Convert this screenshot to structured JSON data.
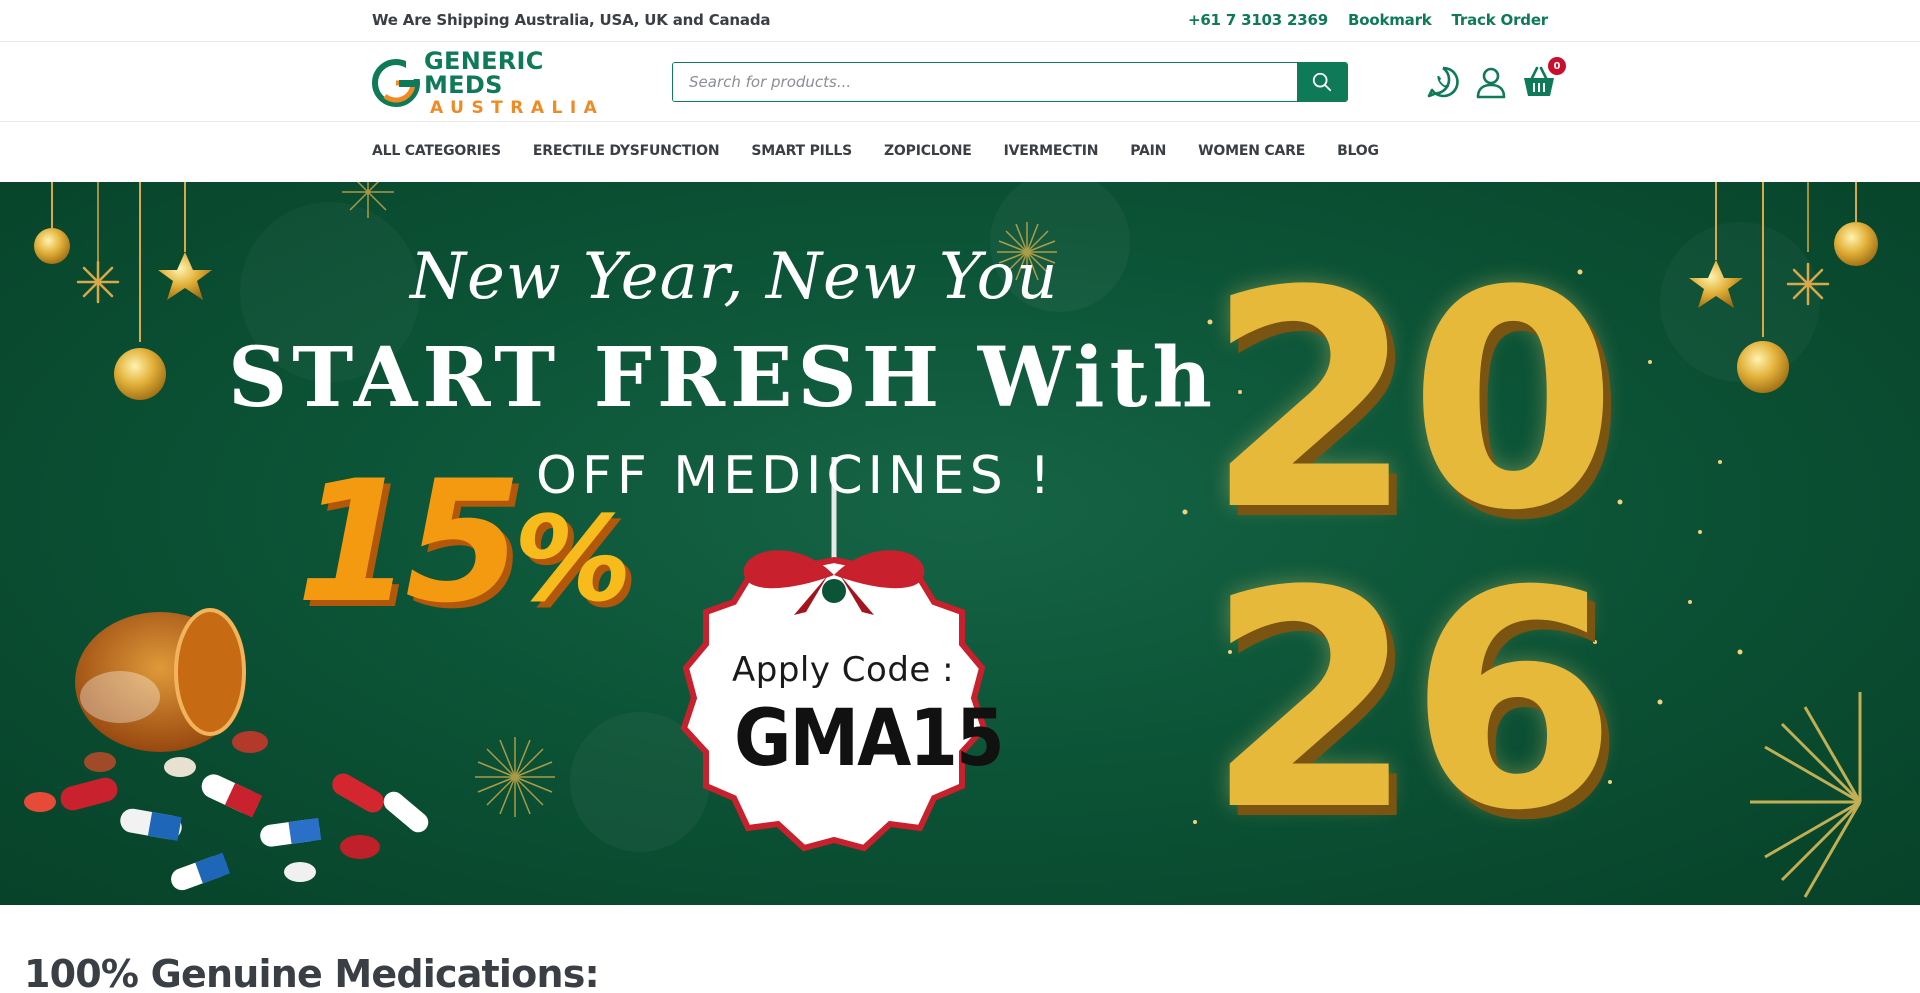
{
  "topbar": {
    "shipping_text": "We Are Shipping Australia, USA, UK and Canada",
    "phone": "+61 7 3103 2369",
    "bookmark": "Bookmark",
    "track_order": "Track Order"
  },
  "header": {
    "logo": {
      "line1": "GENERIC MEDS",
      "line2": "AUSTRALIA"
    },
    "search_placeholder": "Search for products...",
    "cart_count": "0"
  },
  "nav": {
    "items": [
      "ALL CATEGORIES",
      "ERECTILE DYSFUNCTION",
      "SMART PILLS",
      "ZOPICLONE",
      "IVERMECTIN",
      "PAIN",
      "WOMEN CARE",
      "BLOG"
    ]
  },
  "banner": {
    "line1": "New Year, New You",
    "line2": "START FRESH With",
    "line3": "OFF MEDICINES !",
    "percent": "15",
    "percent_symbol": "%",
    "code_label": "Apply Code :",
    "code": "GMA15",
    "year_top": "20",
    "year_bottom": "26"
  },
  "main": {
    "headline": "100% Genuine Medications:"
  },
  "colors": {
    "brand_green": "#0e7a57",
    "brand_orange": "#f08a24",
    "banner_green": "#0c5437",
    "gold": "#e6b93a",
    "badge_red": "#c8102e"
  },
  "icons": [
    "search-icon",
    "whatsapp-icon",
    "user-icon",
    "cart-icon"
  ]
}
